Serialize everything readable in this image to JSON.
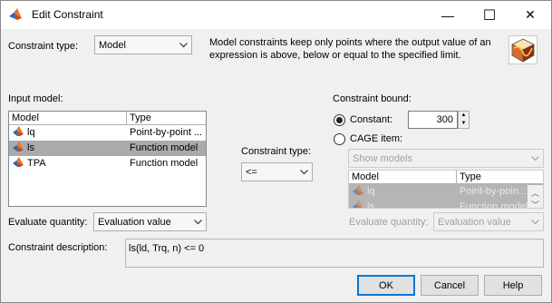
{
  "window": {
    "title": "Edit Constraint",
    "minimize_glyph": "—",
    "maximize_glyph": "☐",
    "close_glyph": "✕"
  },
  "constraint_type": {
    "label": "Constraint type:",
    "value": "Model",
    "info": "Model constraints keep only points where the output value of an expression is above, below or equal to the specified limit."
  },
  "input_model": {
    "label": "Input model:",
    "columns": [
      "Model",
      "Type"
    ],
    "rows": [
      {
        "model": "lq",
        "type": "Point-by-point ...",
        "selected": false
      },
      {
        "model": "ls",
        "type": "Function model",
        "selected": true
      },
      {
        "model": "TPA",
        "type": "Function model",
        "selected": false
      }
    ]
  },
  "middle": {
    "label": "Constraint type:",
    "operator": "<="
  },
  "bound": {
    "label": "Constraint bound:",
    "constant_label": "Constant:",
    "constant_value": "300",
    "cage_label": "CAGE item:",
    "show_models": "Show models",
    "columns": [
      "Model",
      "Type"
    ],
    "rows": [
      {
        "model": "lq",
        "type": "Point-by-poin..."
      },
      {
        "model": "ls",
        "type": "Function model"
      }
    ]
  },
  "evaluate_left": {
    "label": "Evaluate quantity:",
    "value": "Evaluation value"
  },
  "evaluate_right": {
    "label": "Evaluate quantity:",
    "value": "Evaluation value"
  },
  "description": {
    "label": "Constraint description:",
    "value": "ls(ld, Trq, n) <= 0"
  },
  "buttons": {
    "ok": "OK",
    "cancel": "Cancel",
    "help": "Help"
  },
  "icons": {
    "app": "matlab-icon",
    "model": "model-icon",
    "dropdown": "chevron-down-icon",
    "illustration": "surface-plot-icon"
  },
  "colors": {
    "selection": "#aaaaaa",
    "default_button_border": "#0078d7",
    "window_bg": "#f0f0f0"
  }
}
